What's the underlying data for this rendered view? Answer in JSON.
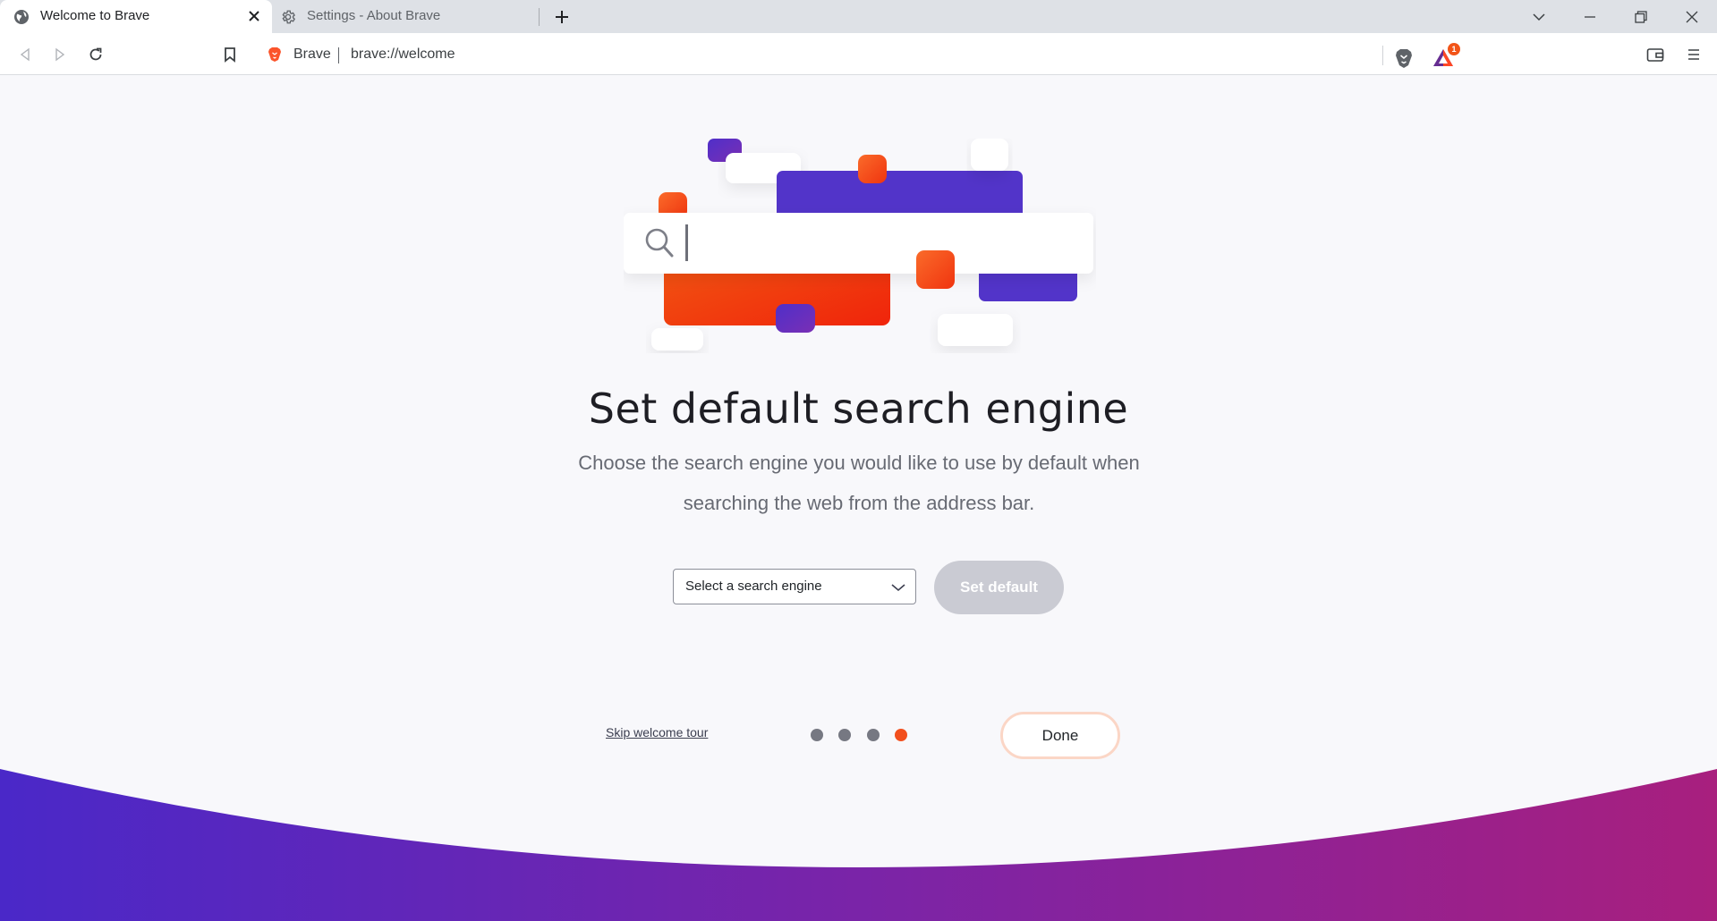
{
  "tabs": [
    {
      "title": "Welcome to Brave",
      "active": true
    },
    {
      "title": "Settings - About Brave",
      "active": false
    }
  ],
  "omnibox": {
    "brand": "Brave",
    "url": "brave://welcome"
  },
  "extensions": {
    "rewards_badge": "1"
  },
  "welcome": {
    "heading": "Set default search engine",
    "description": "Choose the search engine you would like to use by default when searching the web from the address bar.",
    "select_placeholder": "Select a search engine",
    "set_default_label": "Set default",
    "skip_label": "Skip welcome tour",
    "done_label": "Done",
    "steps_total": 4,
    "current_step": 4
  },
  "colors": {
    "accent_orange": "#f24f1d",
    "accent_purple": "#5234c9",
    "wave_start": "#4a28c8",
    "wave_end": "#a81f7e"
  }
}
